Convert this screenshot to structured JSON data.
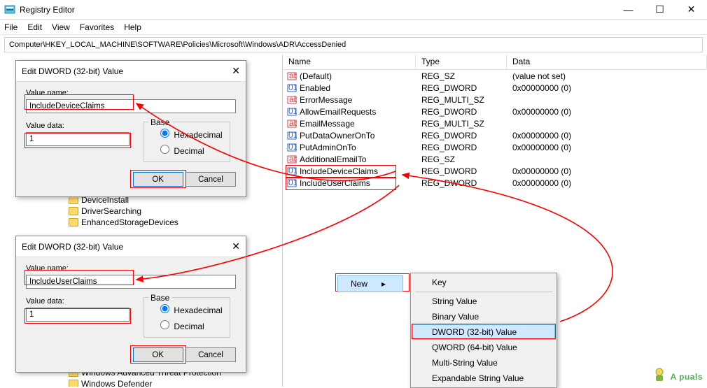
{
  "window": {
    "title": "Registry Editor",
    "buttons": {
      "min": "—",
      "max": "☐",
      "close": "✕"
    }
  },
  "menu": [
    "File",
    "Edit",
    "View",
    "Favorites",
    "Help"
  ],
  "address": "Computer\\HKEY_LOCAL_MACHINE\\SOFTWARE\\Policies\\Microsoft\\Windows\\ADR\\AccessDenied",
  "columns": {
    "name": "Name",
    "type": "Type",
    "data": "Data"
  },
  "rows": [
    {
      "icon": "sz",
      "name": "(Default)",
      "type": "REG_SZ",
      "data": "(value not set)"
    },
    {
      "icon": "dw",
      "name": "Enabled",
      "type": "REG_DWORD",
      "data": "0x00000000 (0)"
    },
    {
      "icon": "sz",
      "name": "ErrorMessage",
      "type": "REG_MULTI_SZ",
      "data": ""
    },
    {
      "icon": "dw",
      "name": "AllowEmailRequests",
      "type": "REG_DWORD",
      "data": "0x00000000 (0)"
    },
    {
      "icon": "sz",
      "name": "EmailMessage",
      "type": "REG_MULTI_SZ",
      "data": ""
    },
    {
      "icon": "dw",
      "name": "PutDataOwnerOnTo",
      "type": "REG_DWORD",
      "data": "0x00000000 (0)"
    },
    {
      "icon": "dw",
      "name": "PutAdminOnTo",
      "type": "REG_DWORD",
      "data": "0x00000000 (0)"
    },
    {
      "icon": "sz",
      "name": "AdditionalEmailTo",
      "type": "REG_SZ",
      "data": ""
    },
    {
      "icon": "dw",
      "name": "IncludeDeviceClaims",
      "type": "REG_DWORD",
      "data": "0x00000000 (0)"
    },
    {
      "icon": "dw",
      "name": "IncludeUserClaims",
      "type": "REG_DWORD",
      "data": "0x00000000 (0)"
    }
  ],
  "tree_visible": [
    "DeviceInstall",
    "DriverSearching",
    "EnhancedStorageDevices",
    "Windows Advanced Threat Protection",
    "Windows Defender"
  ],
  "dialog": {
    "title": "Edit DWORD (32-bit) Value",
    "value_name_lbl": "Value name:",
    "value_data_lbl": "Value data:",
    "base_lbl": "Base",
    "hex": "Hexadecimal",
    "dec": "Decimal",
    "ok": "OK",
    "cancel": "Cancel"
  },
  "dlg1": {
    "name": "IncludeDeviceClaims",
    "data": "1"
  },
  "dlg2": {
    "name": "IncludeUserClaims",
    "data": "1"
  },
  "context": {
    "new": "New",
    "items": [
      "Key",
      "String Value",
      "Binary Value",
      "DWORD (32-bit) Value",
      "QWORD (64-bit) Value",
      "Multi-String Value",
      "Expandable String Value"
    ]
  },
  "watermark": "A  puals"
}
